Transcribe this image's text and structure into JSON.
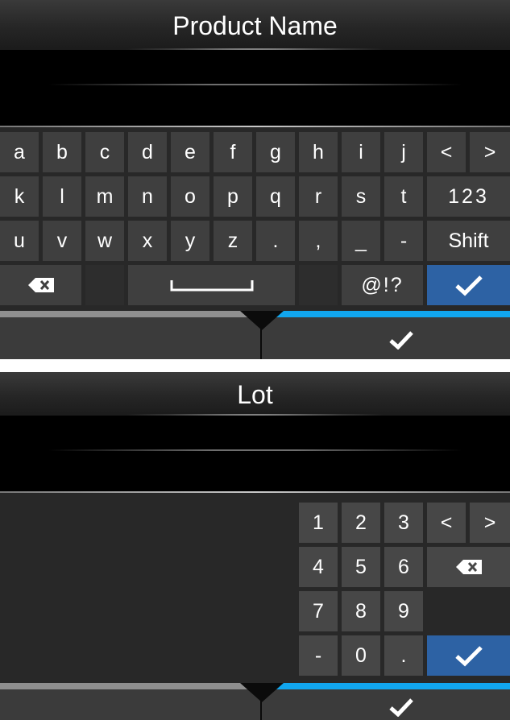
{
  "top_screen": {
    "title": "Product Name",
    "input_value": "",
    "keys_row1": [
      "a",
      "b",
      "c",
      "d",
      "e",
      "f",
      "g",
      "h",
      "i",
      "j"
    ],
    "keys_row2": [
      "k",
      "l",
      "m",
      "n",
      "o",
      "p",
      "q",
      "r",
      "s",
      "t"
    ],
    "keys_row3": [
      "u",
      "v",
      "w",
      "x",
      "y",
      "z",
      ".",
      ",",
      "_",
      "-"
    ],
    "cursor_left": "<",
    "cursor_right": ">",
    "mode_numbers": "123",
    "shift": "Shift",
    "symbols": "@!?",
    "icons": {
      "backspace": "backspace-icon",
      "space": "space-bar-icon",
      "enter": "checkmark-icon",
      "confirm": "checkmark-icon"
    }
  },
  "bottom_screen": {
    "title": "Lot",
    "input_value": "",
    "numpad_row1": [
      "1",
      "2",
      "3"
    ],
    "numpad_row2": [
      "4",
      "5",
      "6"
    ],
    "numpad_row3": [
      "7",
      "8",
      "9"
    ],
    "numpad_row4": [
      "-",
      "0",
      "."
    ],
    "cursor_left": "<",
    "cursor_right": ">",
    "icons": {
      "backspace": "backspace-icon",
      "enter": "checkmark-icon",
      "confirm": "checkmark-icon"
    }
  },
  "colors": {
    "accent_blue": "#11a6ee",
    "enter_key": "#2d62a4",
    "key": "#3f3f3f",
    "background": "#0b0b0b"
  }
}
